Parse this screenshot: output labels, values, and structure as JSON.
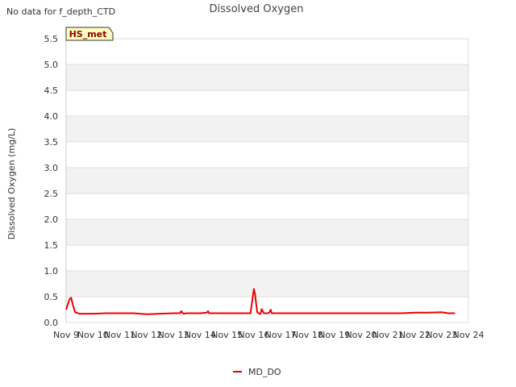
{
  "page": {
    "note": "No data for f_depth_CTD"
  },
  "chart_data": {
    "type": "line",
    "title": "Dissolved Oxygen",
    "ylabel": "Dissolved Oxygen (mg/L)",
    "xlabel": "",
    "badge": "HS_met",
    "ylim": [
      0.0,
      5.5
    ],
    "yticks": [
      "0.0",
      "0.5",
      "1.0",
      "1.5",
      "2.0",
      "2.5",
      "3.0",
      "3.5",
      "4.0",
      "4.5",
      "5.0",
      "5.5"
    ],
    "xlim": [
      "2023-11-09",
      "2023-11-24"
    ],
    "xticks": [
      "Nov 9",
      "Nov 10",
      "Nov 11",
      "Nov 12",
      "Nov 13",
      "Nov 14",
      "Nov 15",
      "Nov 16",
      "Nov 17",
      "Nov 18",
      "Nov 19",
      "Nov 20",
      "Nov 21",
      "Nov 22",
      "Nov 23",
      "Nov 24"
    ],
    "grid": true,
    "legend_position": "bottom-center",
    "colors": {
      "series": "#ee0000",
      "band": "#f2f2f2",
      "badge_bg": "#ffffc0",
      "badge_text": "#8b0000"
    },
    "series": [
      {
        "name": "MD_DO",
        "x": [
          "2023-11-09T00:00",
          "2023-11-09T03:00",
          "2023-11-09T04:30",
          "2023-11-09T06:00",
          "2023-11-09T08:00",
          "2023-11-09T12:00",
          "2023-11-10T00:00",
          "2023-11-10T12:00",
          "2023-11-11T00:00",
          "2023-11-11T12:00",
          "2023-11-12T00:00",
          "2023-11-12T12:00",
          "2023-11-13T00:00",
          "2023-11-13T06:00",
          "2023-11-13T07:00",
          "2023-11-13T09:00",
          "2023-11-13T12:00",
          "2023-11-14T00:00",
          "2023-11-14T06:00",
          "2023-11-14T07:00",
          "2023-11-14T08:00",
          "2023-11-14T12:00",
          "2023-11-14T20:00",
          "2023-11-15T00:00",
          "2023-11-15T12:00",
          "2023-11-15T21:00",
          "2023-11-16T00:00",
          "2023-11-16T01:00",
          "2023-11-16T03:00",
          "2023-11-16T05:00",
          "2023-11-16T06:00",
          "2023-11-16T07:00",
          "2023-11-16T09:00",
          "2023-11-16T11:00",
          "2023-11-16T13:00",
          "2023-11-16T14:00",
          "2023-11-16T15:00",
          "2023-11-16T16:00",
          "2023-11-16T17:00",
          "2023-11-16T18:00",
          "2023-11-16T20:00",
          "2023-11-16T22:00",
          "2023-11-16T23:00",
          "2023-11-17T00:00",
          "2023-11-17T01:00",
          "2023-11-17T02:00",
          "2023-11-17T03:00",
          "2023-11-17T04:00",
          "2023-11-17T05:00",
          "2023-11-17T06:00",
          "2023-11-17T08:00",
          "2023-11-17T12:00",
          "2023-11-18T00:00",
          "2023-11-18T01:00",
          "2023-11-18T02:00",
          "2023-11-18T03:00",
          "2023-11-18T04:00",
          "2023-11-18T06:00",
          "2023-11-18T12:00",
          "2023-11-19T00:00",
          "2023-11-19T01:00",
          "2023-11-19T02:00",
          "2023-11-19T03:00",
          "2023-11-19T04:00",
          "2023-11-19T06:00",
          "2023-11-19T08:00",
          "2023-11-19T10:00",
          "2023-11-19T12:00",
          "2023-11-19T18:00",
          "2023-11-20T00:00",
          "2023-11-20T02:00",
          "2023-11-20T03:00",
          "2023-11-20T04:00",
          "2023-11-20T05:00",
          "2023-11-20T06:00",
          "2023-11-20T07:00",
          "2023-11-20T08:00",
          "2023-11-20T09:00",
          "2023-11-20T10:00",
          "2023-11-20T11:00",
          "2023-11-20T12:00",
          "2023-11-20T14:00",
          "2023-11-20T16:00",
          "2023-11-20T18:00",
          "2023-11-20T19:00",
          "2023-11-20T20:00",
          "2023-11-20T21:00",
          "2023-11-20T22:00",
          "2023-11-21T00:00",
          "2023-11-21T12:00",
          "2023-11-22T00:00",
          "2023-11-22T12:00",
          "2023-11-23T00:00",
          "2023-11-23T06:00",
          "2023-11-23T12:00"
        ],
        "values": [
          0.25,
          0.45,
          0.48,
          0.35,
          0.2,
          0.17,
          0.17,
          0.18,
          0.18,
          0.18,
          0.16,
          0.17,
          0.18,
          0.18,
          0.22,
          0.17,
          0.18,
          0.18,
          0.19,
          0.22,
          0.18,
          0.18,
          0.18,
          0.18,
          0.18,
          0.18,
          0.65,
          0.55,
          0.2,
          0.17,
          0.17,
          0.26,
          0.18,
          0.18,
          0.18,
          0.2,
          0.25,
          0.18,
          0.18,
          0.18,
          0.18,
          0.18,
          0.18,
          0.18,
          0.18,
          0.18,
          0.18,
          0.18,
          0.18,
          0.18,
          0.18,
          0.18,
          0.18,
          0.18,
          0.18,
          0.18,
          0.18,
          0.18,
          0.18,
          0.18,
          0.18,
          0.18,
          0.18,
          0.18,
          0.18,
          0.18,
          0.18,
          0.18,
          0.18,
          0.18,
          0.18,
          0.18,
          0.18,
          0.18,
          0.18,
          0.18,
          0.18,
          0.18,
          0.18,
          0.18,
          0.18,
          0.18,
          0.18,
          0.18,
          0.18,
          0.18,
          0.18,
          0.18,
          0.18,
          0.18,
          0.19,
          0.19,
          0.2,
          0.18,
          0.18
        ]
      }
    ]
  }
}
